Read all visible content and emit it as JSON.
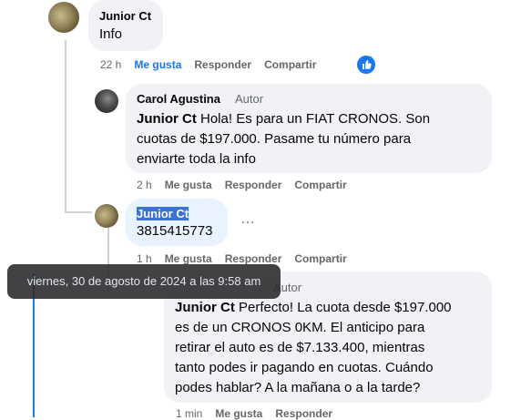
{
  "comments": [
    {
      "author": "Junior Ct",
      "text": "Info",
      "actions": {
        "time": "22 h",
        "like": "Me gusta",
        "reply": "Responder",
        "share": "Compartir"
      }
    },
    {
      "author": "Carol Agustina",
      "badge": "Autor",
      "mention": "Junior Ct",
      "lines": [
        " Hola! Es para un FIAT CRONOS. Son",
        "cuotas de $197.000. Pasame tu número para",
        "enviarte toda la info"
      ],
      "actions": {
        "time": "2 h",
        "like": "Me gusta",
        "reply": "Responder",
        "share": "Compartir"
      }
    },
    {
      "author": "Junior Ct",
      "text": "3815415773",
      "more": "…",
      "actions": {
        "time": "1 h",
        "like": "Me gusta",
        "reply": "Responder",
        "share": "Compartir"
      }
    },
    {
      "badge": "Autor",
      "mention": "Junior Ct",
      "lines": [
        " Perfecto! La cuota desde $197.000",
        "es de un CRONOS 0KM. El anticipo para",
        "retirar el auto es de $7.133.400, mientras",
        "tanto podes ir pagando en cuotas. Cuándo",
        "podes hablar? A la mañana o a la tarde?"
      ],
      "actions": {
        "time": "1 min",
        "like": "Me gusta",
        "reply": "Responder"
      }
    }
  ],
  "tooltip": "viernes, 30 de agosto de 2024 a las 9:58 am",
  "colors": {
    "like_active": "#1877f2",
    "bubble": "#f0f2f5",
    "thread_line": "#ced0d4"
  }
}
